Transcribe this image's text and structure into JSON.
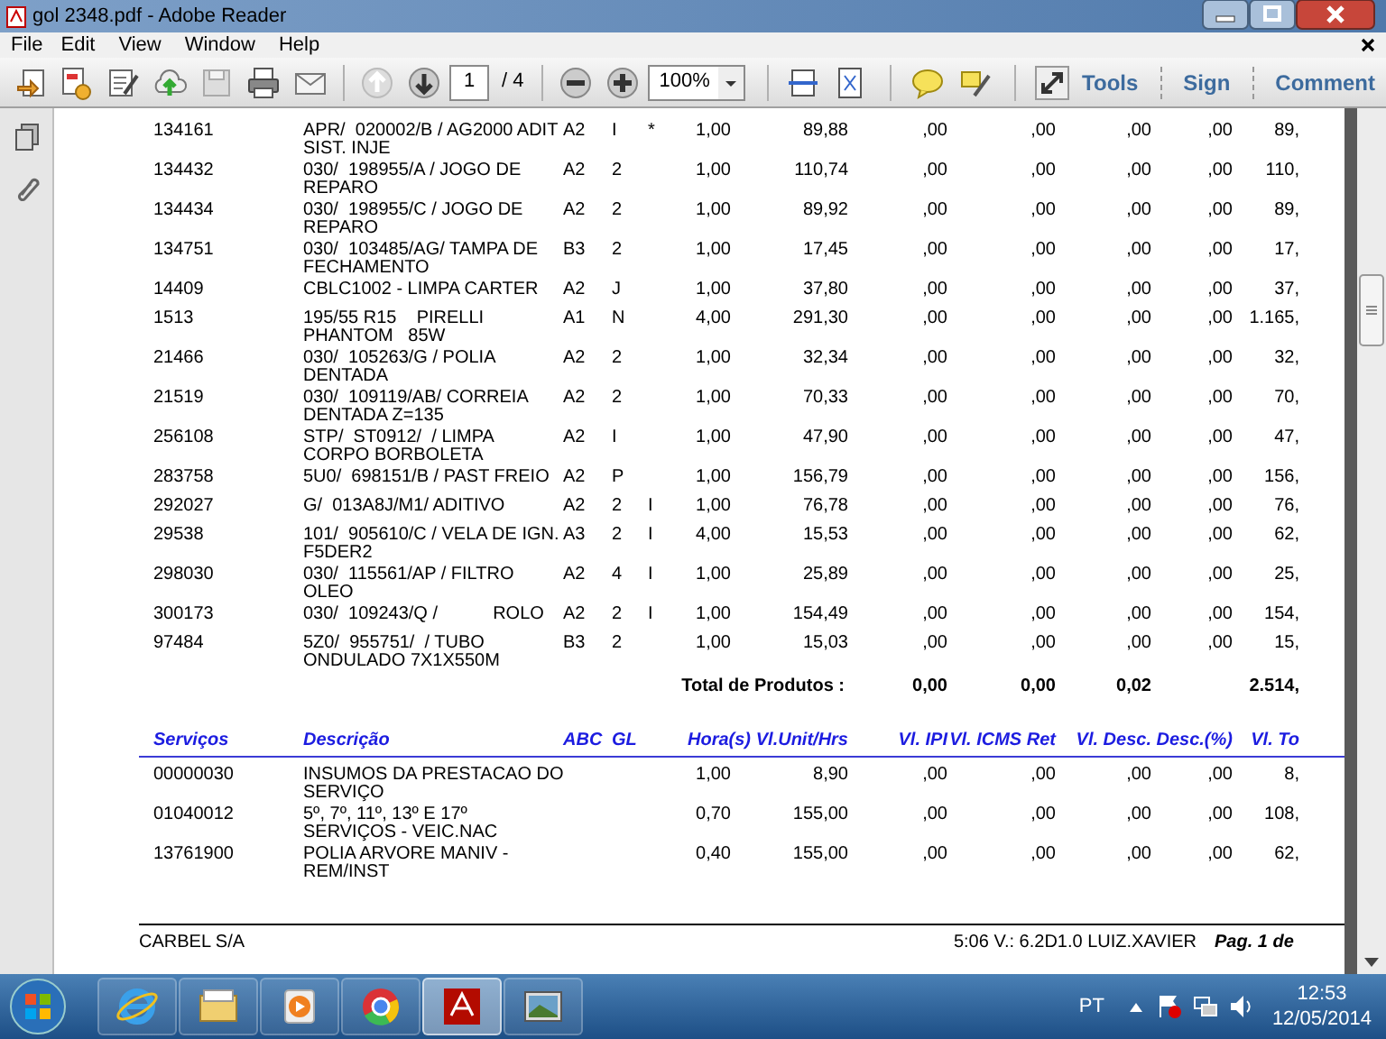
{
  "window": {
    "title": "gol 2348.pdf - Adobe Reader"
  },
  "menu": [
    "File",
    "Edit",
    "View",
    "Window",
    "Help"
  ],
  "toolbar": {
    "page": "1",
    "page_total": "/ 4",
    "zoom": "100%",
    "panes": [
      "Tools",
      "Sign",
      "Comment"
    ]
  },
  "items": {
    "rows": [
      [
        "134161",
        "APR/  020002/B / AG2000 ADIT\nSIST. INJE",
        "A2",
        "I",
        "*",
        "1,00",
        "89,88",
        ",00",
        ",00",
        ",00",
        ",00",
        "89,"
      ],
      [
        "134432",
        "030/  198955/A / JOGO DE\nREPARO",
        "A2",
        "2",
        null,
        "1,00",
        "110,74",
        ",00",
        ",00",
        ",00",
        ",00",
        "110,"
      ],
      [
        "134434",
        "030/  198955/C / JOGO DE\nREPARO",
        "A2",
        "2",
        null,
        "1,00",
        "89,92",
        ",00",
        ",00",
        ",00",
        ",00",
        "89,"
      ],
      [
        "134751",
        "030/  103485/AG/ TAMPA DE\nFECHAMENTO",
        "B3",
        "2",
        null,
        "1,00",
        "17,45",
        ",00",
        ",00",
        ",00",
        ",00",
        "17,"
      ],
      [
        "14409",
        "CBLC1002 - LIMPA CARTER",
        "A2",
        "J",
        null,
        "1,00",
        "37,80",
        ",00",
        ",00",
        ",00",
        ",00",
        "37,"
      ],
      [
        "1513",
        "195/55 R15    PIRELLI\nPHANTOM   85W",
        "A1",
        "N",
        null,
        "4,00",
        "291,30",
        ",00",
        ",00",
        ",00",
        ",00",
        "1.165,"
      ],
      [
        "21466",
        "030/  105263/G / POLIA\nDENTADA",
        "A2",
        "2",
        null,
        "1,00",
        "32,34",
        ",00",
        ",00",
        ",00",
        ",00",
        "32,"
      ],
      [
        "21519",
        "030/  109119/AB/ CORREIA\nDENTADA Z=135",
        "A2",
        "2",
        null,
        "1,00",
        "70,33",
        ",00",
        ",00",
        ",00",
        ",00",
        "70,"
      ],
      [
        "256108",
        "STP/  ST0912/  / LIMPA\nCORPO BORBOLETA",
        "A2",
        "I",
        null,
        "1,00",
        "47,90",
        ",00",
        ",00",
        ",00",
        ",00",
        "47,"
      ],
      [
        "283758",
        "5U0/  698151/B / PAST FREIO",
        "A2",
        "P",
        null,
        "1,00",
        "156,79",
        ",00",
        ",00",
        ",00",
        ",00",
        "156,"
      ],
      [
        "292027",
        "G/  013A8J/M1/ ADITIVO",
        "A2",
        "2",
        "I",
        "1,00",
        "76,78",
        ",00",
        ",00",
        ",00",
        ",00",
        "76,"
      ],
      [
        "29538",
        "101/  905610/C / VELA DE IGN.\nF5DER2",
        "A3",
        "2",
        "I",
        "4,00",
        "15,53",
        ",00",
        ",00",
        ",00",
        ",00",
        "62,"
      ],
      [
        "298030",
        "030/  115561/AP / FILTRO\nOLEO",
        "A2",
        "4",
        "I",
        "1,00",
        "25,89",
        ",00",
        ",00",
        ",00",
        ",00",
        "25,"
      ],
      [
        "300173",
        "030/  109243/Q /           ROLO",
        "A2",
        "2",
        "I",
        "1,00",
        "154,49",
        ",00",
        ",00",
        ",00",
        ",00",
        "154,"
      ],
      [
        "97484",
        "5Z0/  955751/  / TUBO\nONDULADO 7X1X550M",
        "B3",
        "2",
        null,
        "1,00",
        "15,03",
        ",00",
        ",00",
        ",00",
        ",00",
        "15,"
      ]
    ],
    "total": {
      "label": "Total de Produtos :",
      "values": [
        "0,00",
        "0,00",
        "0,02",
        "2.514,"
      ]
    }
  },
  "services": {
    "columns": [
      "Serviços",
      "Descrição",
      "ABC",
      "GL",
      "Hora(s)",
      "Vl.Unit/Hrs",
      "Vl. IPI",
      "Vl. ICMS Ret",
      "Vl. Desc.",
      "Desc.(%)",
      "Vl. To"
    ],
    "rows": [
      [
        "00000030",
        "INSUMOS DA PRESTACAO DO\nSERVIÇO",
        null,
        null,
        "1,00",
        "8,90",
        ",00",
        ",00",
        ",00",
        ",00",
        "8,"
      ],
      [
        "01040012",
        "5º, 7º, 11º, 13º E 17º\nSERVIÇOS - VEIC.NAC",
        null,
        null,
        "0,70",
        "155,00",
        ",00",
        ",00",
        ",00",
        ",00",
        "108,"
      ],
      [
        "13761900",
        "POLIA ARVORE MANIV -\nREM/INST",
        null,
        null,
        "0,40",
        "155,00",
        ",00",
        ",00",
        ",00",
        ",00",
        "62,"
      ]
    ]
  },
  "footer": {
    "company": "CARBEL S/A",
    "version": "5:06 V.: 6.2D1.0 LUIZ.XAVIER",
    "page": "Pag. 1 de"
  },
  "taskbar": {
    "apps": [
      {
        "kind": "ie",
        "selected": false
      },
      {
        "kind": "folder",
        "selected": false
      },
      {
        "kind": "media",
        "selected": false
      },
      {
        "kind": "chrome",
        "selected": false
      },
      {
        "kind": "pdf",
        "selected": true
      },
      {
        "kind": "picture",
        "selected": false
      }
    ],
    "language": "PT",
    "time": "12:53",
    "date": "12/05/2014"
  }
}
